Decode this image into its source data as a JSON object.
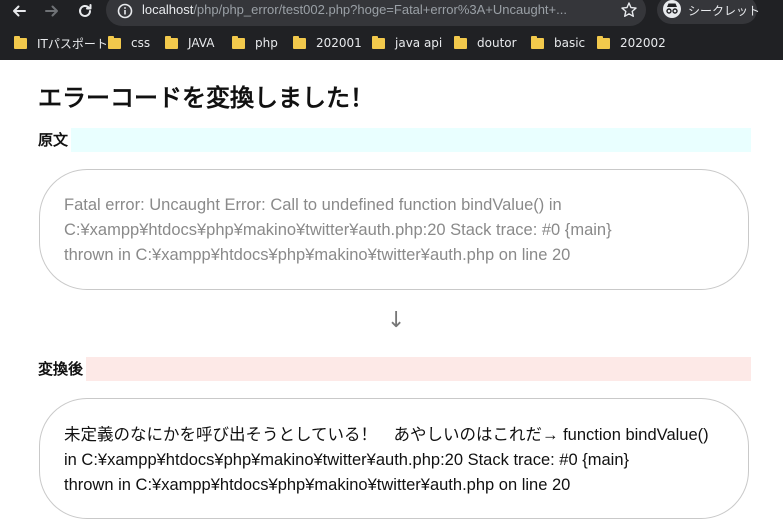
{
  "browser": {
    "url_host": "localhost",
    "url_rest": "/php/php_error/test002.php?hoge=Fatal+error%3A+Uncaught+...",
    "incognito_label": "シークレット",
    "bookmarks": [
      "ITパスポート",
      "css",
      "JAVA",
      "php",
      "202001",
      "java api",
      "doutor",
      "basic",
      "202002"
    ]
  },
  "page": {
    "title": "エラーコードを変換しました！",
    "original_heading": "原文",
    "original_lines": [
      "Fatal error: Uncaught Error: Call to undefined function bindValue() in",
      "C:¥xampp¥htdocs¥php¥makino¥twitter¥auth.php:20 Stack trace: #0 {main}",
      "thrown in C:¥xampp¥htdocs¥php¥makino¥twitter¥auth.php on line 20"
    ],
    "arrow": "↓",
    "converted_heading": "変換後",
    "converted_lines": [
      "未定義のなにかを呼び出そうとしている！　あやしいのはこれだ→ function bindValue()",
      "in C:¥xampp¥htdocs¥php¥makino¥twitter¥auth.php:20 Stack trace: #0 {main}",
      "thrown in C:¥xampp¥htdocs¥php¥makino¥twitter¥auth.php on line 20"
    ]
  },
  "colors": {
    "chrome_bg": "#202124",
    "original_heading_bg": "#e9ffff",
    "converted_heading_bg": "#fde9e7"
  }
}
